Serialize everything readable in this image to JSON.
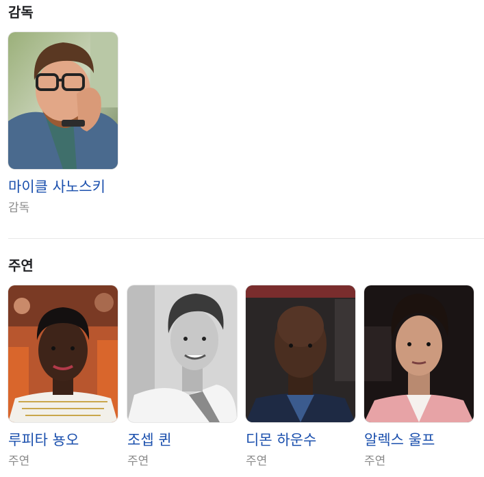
{
  "director_section": {
    "title": "감독",
    "people": [
      {
        "name": "마이클 사노스키",
        "role": "감독",
        "photo_icon": "person-photo-glasses"
      }
    ]
  },
  "cast_section": {
    "title": "주연",
    "people": [
      {
        "name": "루피타 뇽오",
        "role": "주연",
        "photo_icon": "person-photo"
      },
      {
        "name": "조셉 퀸",
        "role": "주연",
        "photo_icon": "person-photo-bw"
      },
      {
        "name": "디몬 하운수",
        "role": "주연",
        "photo_icon": "person-photo"
      },
      {
        "name": "알렉스 울프",
        "role": "주연",
        "photo_icon": "person-photo"
      }
    ]
  },
  "colors": {
    "link": "#1a4fad",
    "secondary_text": "#8a8a8a",
    "divider": "#e8e8e8"
  }
}
